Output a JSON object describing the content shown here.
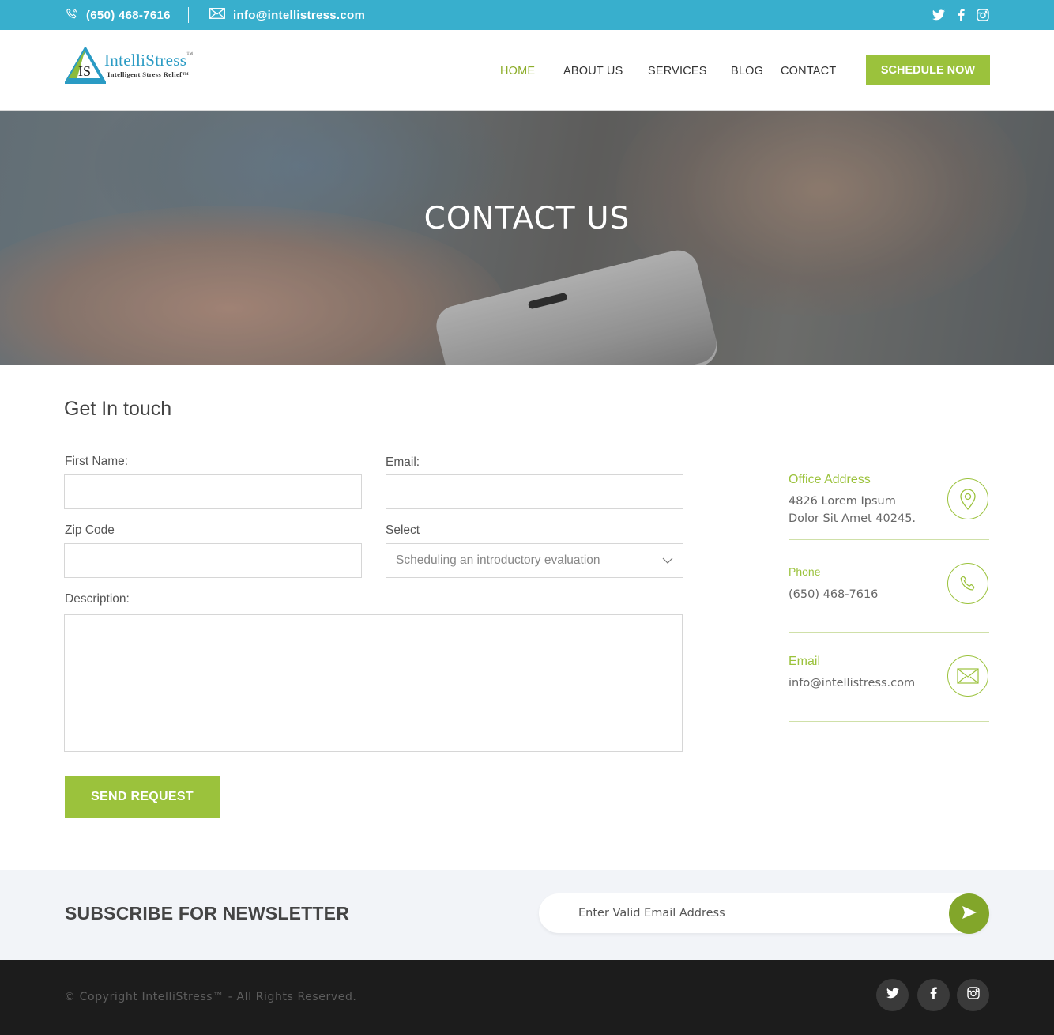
{
  "topbar": {
    "phone": "(650) 468-7616",
    "email": "info@intellistress.com",
    "socials": [
      "twitter-icon",
      "facebook-icon",
      "instagram-icon"
    ]
  },
  "header": {
    "logo_brand": "IntelliStress",
    "logo_tm": "™",
    "logo_tagline": "Intelligent Stress Relief™",
    "nav": {
      "home": "HOME",
      "about": "ABOUT US",
      "services": "SERVICES",
      "blog": "BLOG",
      "contact": "CONTACT"
    },
    "active_nav": "HOME",
    "cta_label": "SCHEDULE NOW"
  },
  "hero": {
    "title": "CONTACT US"
  },
  "form": {
    "title": "Get In touch",
    "first_name_label": "First Name:",
    "first_name_value": "",
    "email_label": "Email:",
    "email_value": "",
    "zip_label": "Zip Code",
    "zip_value": "",
    "select_label": "Select",
    "select_value": "Scheduling an introductory evaluation",
    "description_label": "Description:",
    "description_value": "",
    "submit_label": "SEND REQUEST"
  },
  "info": {
    "address_title": "Office Address",
    "address_line1": "4826 Lorem Ipsum",
    "address_line2": "Dolor Sit Amet 40245.",
    "phone_title": "Phone",
    "phone_value": "(650) 468-7616",
    "email_title": "Email",
    "email_value": "info@intellistress.com"
  },
  "newsletter": {
    "title": "SUBSCRIBE FOR NEWSLETTER",
    "placeholder": "Enter Valid Email Address"
  },
  "footer": {
    "copyright": "© Copyright IntelliStress™ - All Rights Reserved."
  },
  "colors": {
    "topbar": "#38afcd",
    "accent_green": "#9bc23c",
    "footer": "#1c1c1c",
    "newsletter_bg": "#f2f4f8"
  }
}
